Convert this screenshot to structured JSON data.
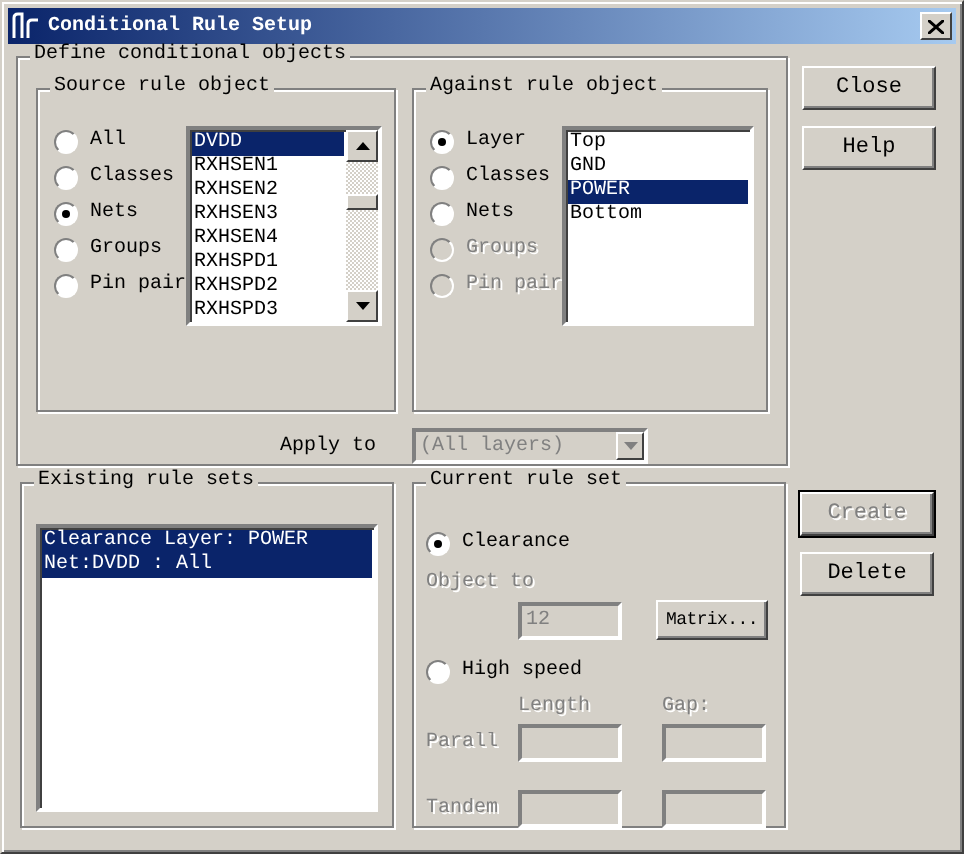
{
  "window": {
    "title": "Conditional Rule Setup"
  },
  "define_group": {
    "label": "Define conditional objects",
    "source": {
      "label": "Source rule object",
      "options": [
        {
          "label": "All",
          "selected": false,
          "disabled": false
        },
        {
          "label": "Classes",
          "selected": false,
          "disabled": false
        },
        {
          "label": "Nets",
          "selected": true,
          "disabled": false
        },
        {
          "label": "Groups",
          "selected": false,
          "disabled": false
        },
        {
          "label": "Pin pair",
          "selected": false,
          "disabled": false
        }
      ],
      "list": [
        {
          "label": "DVDD",
          "selected": true
        },
        {
          "label": "RXHSEN1",
          "selected": false
        },
        {
          "label": "RXHSEN2",
          "selected": false
        },
        {
          "label": "RXHSEN3",
          "selected": false
        },
        {
          "label": "RXHSEN4",
          "selected": false
        },
        {
          "label": "RXHSPD1",
          "selected": false
        },
        {
          "label": "RXHSPD2",
          "selected": false
        },
        {
          "label": "RXHSPD3",
          "selected": false
        }
      ]
    },
    "against": {
      "label": "Against rule object",
      "options": [
        {
          "label": "Layer",
          "selected": true,
          "disabled": false
        },
        {
          "label": "Classes",
          "selected": false,
          "disabled": false
        },
        {
          "label": "Nets",
          "selected": false,
          "disabled": false
        },
        {
          "label": "Groups",
          "selected": false,
          "disabled": true
        },
        {
          "label": "Pin pair",
          "selected": false,
          "disabled": true
        }
      ],
      "list": [
        {
          "label": "Top",
          "selected": false
        },
        {
          "label": "GND",
          "selected": false
        },
        {
          "label": "POWER",
          "selected": true
        },
        {
          "label": "Bottom",
          "selected": false
        }
      ]
    },
    "apply_to": {
      "label": "Apply to",
      "value": "(All layers)",
      "disabled": true
    }
  },
  "side_buttons": [
    {
      "label": "Close",
      "disabled": false,
      "default": false
    },
    {
      "label": "Help",
      "disabled": false,
      "default": false
    }
  ],
  "existing": {
    "label": "Existing rule sets",
    "items": [
      {
        "lines": [
          "Clearance  Layer: POWER",
          "Net:DVDD :  All"
        ],
        "selected": true
      }
    ]
  },
  "current": {
    "label": "Current rule set",
    "clearance": {
      "label": "Clearance",
      "selected": true
    },
    "object_to": {
      "label": "Object to",
      "value": "12",
      "disabled": true
    },
    "matrix_button": {
      "label": "Matrix...",
      "disabled": false
    },
    "high_speed": {
      "label": "High speed",
      "selected": false
    },
    "length_label": "Length",
    "gap_label": "Gap:",
    "rows": [
      {
        "label": "Parall",
        "disabled": true
      },
      {
        "label": "Tandem",
        "disabled": true
      }
    ]
  },
  "rule_buttons": [
    {
      "label": "Create",
      "disabled": true,
      "default": true
    },
    {
      "label": "Delete",
      "disabled": false,
      "default": false
    }
  ]
}
